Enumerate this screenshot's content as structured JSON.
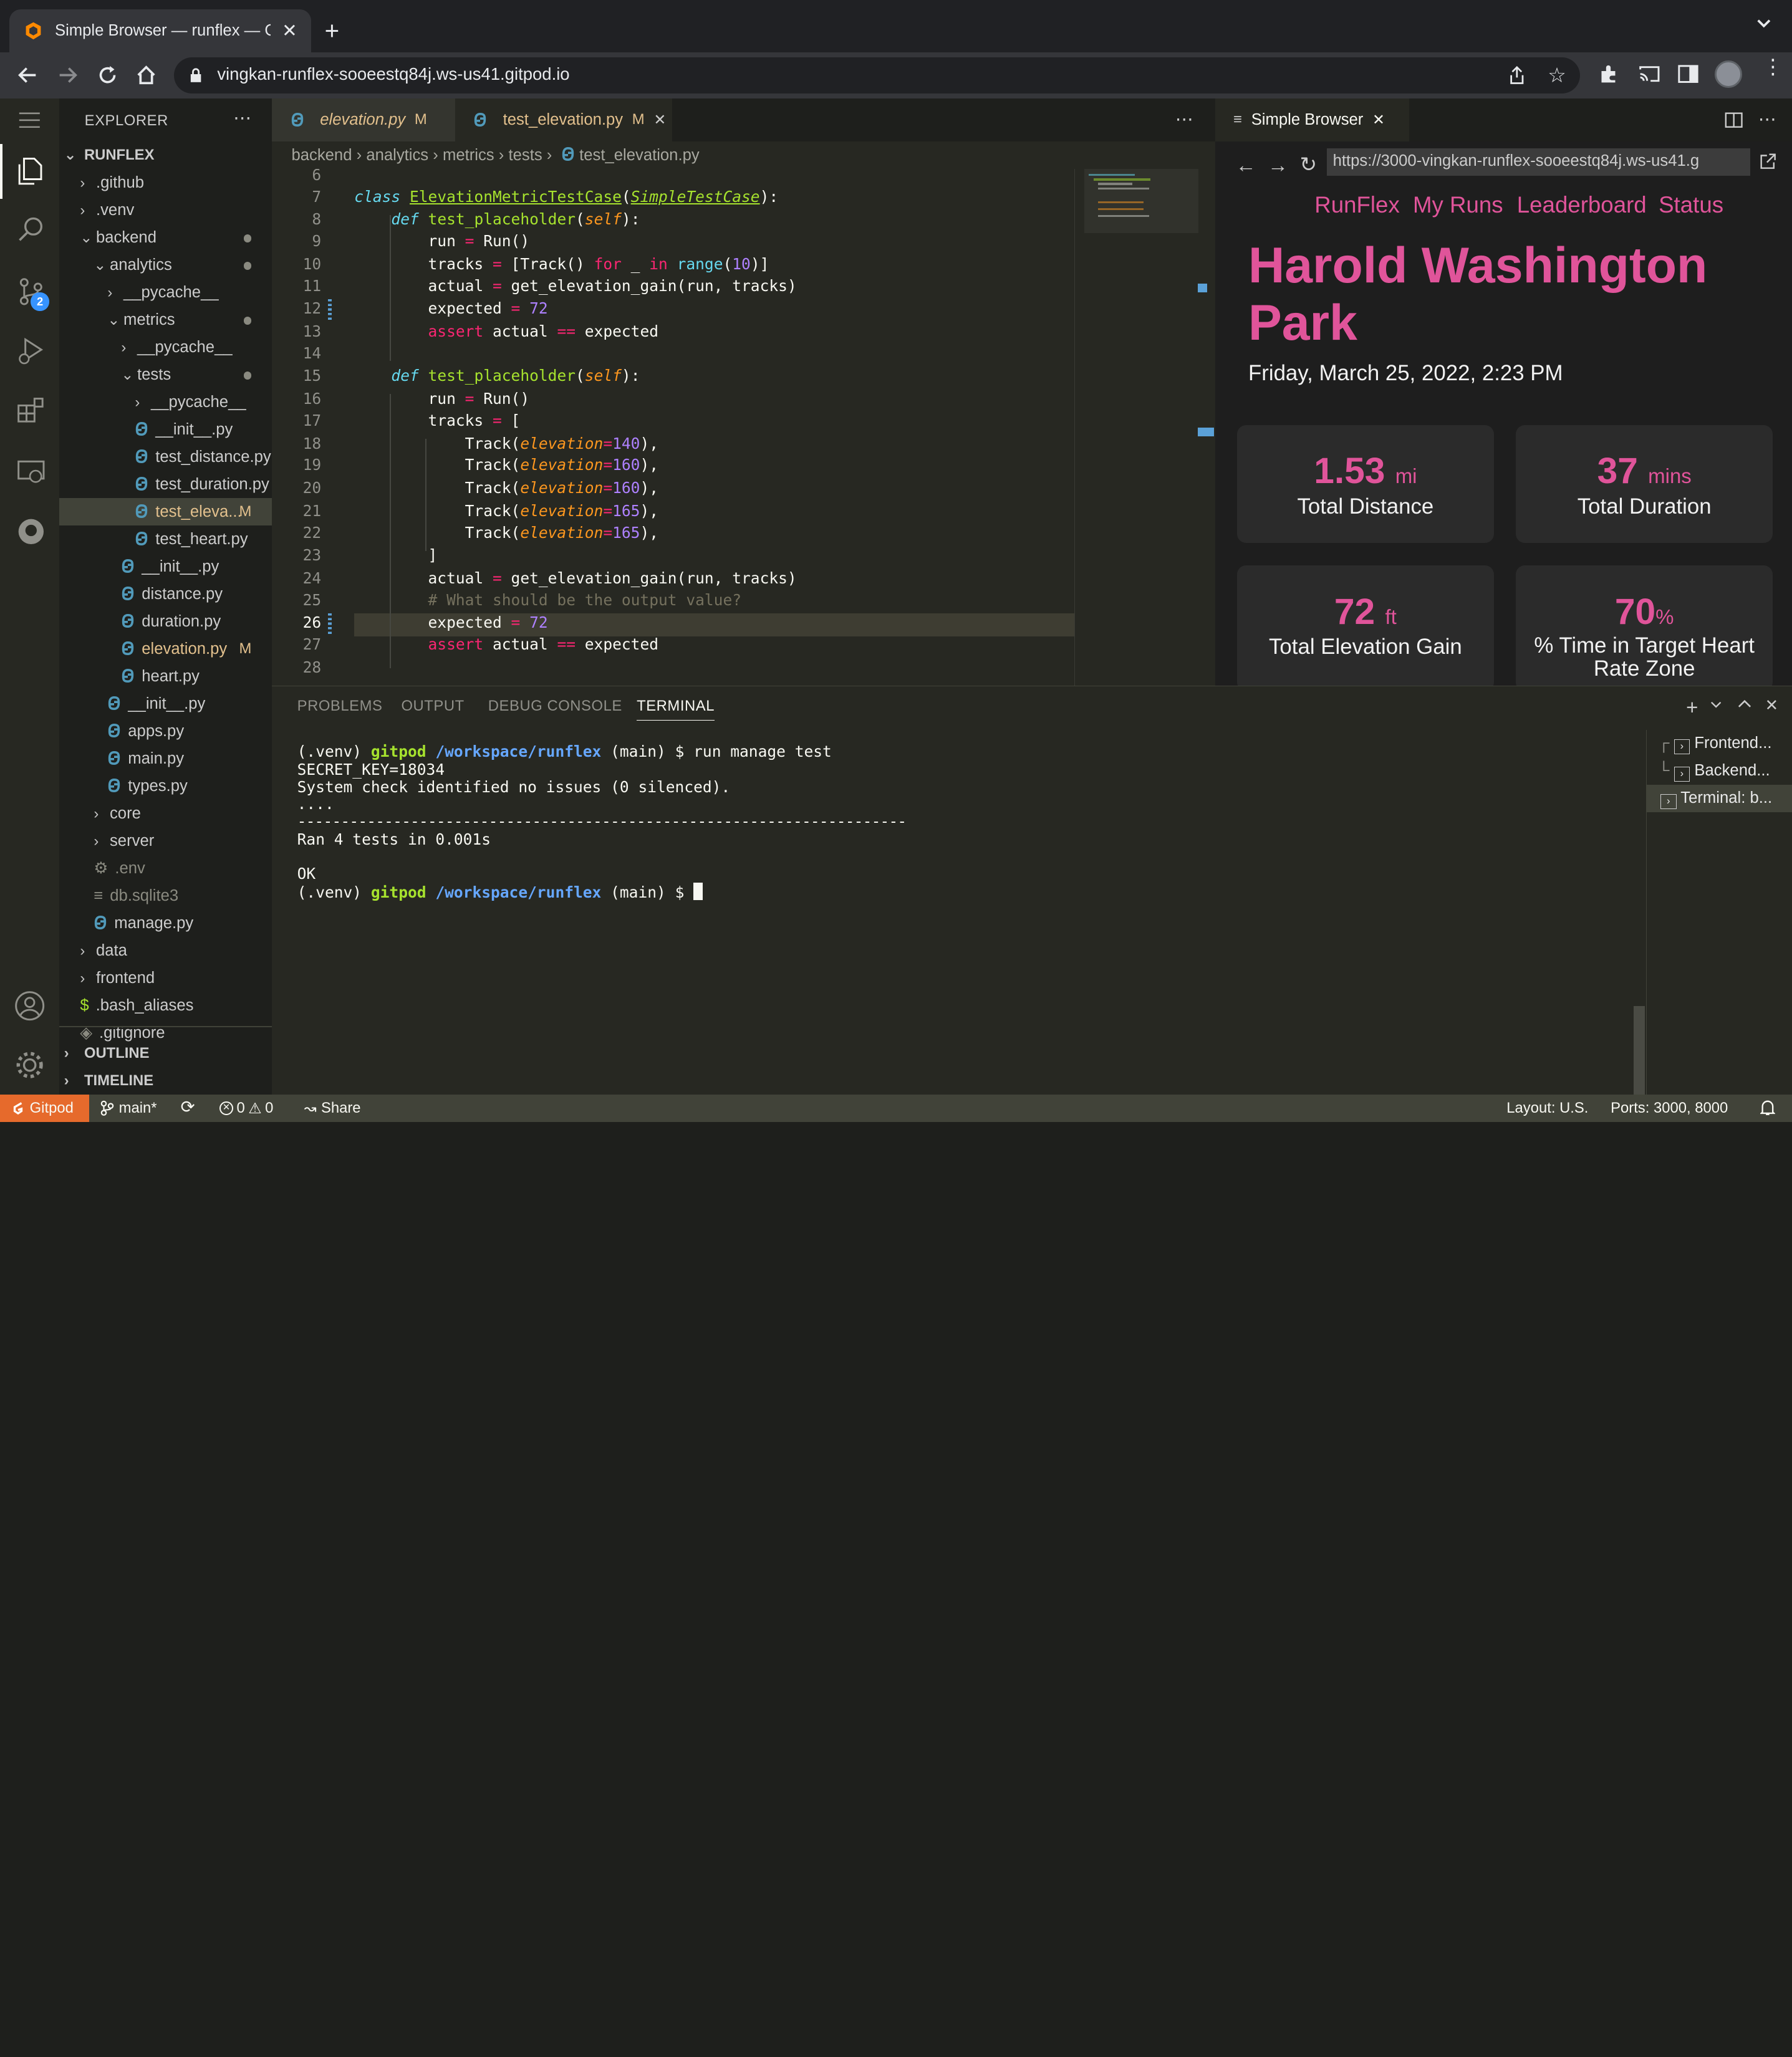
{
  "chrome": {
    "tab_title": "Simple Browser — runflex — G",
    "address": "vingkan-runflex-sooeestq84j.ws-us41.gitpod.io"
  },
  "explorer": {
    "title": "EXPLORER",
    "root": "RUNFLEX",
    "items": [
      {
        "label": ".github"
      },
      {
        "label": ".venv"
      },
      {
        "label": "backend"
      },
      {
        "label": "analytics"
      },
      {
        "label": "__pycache__"
      },
      {
        "label": "metrics"
      },
      {
        "label": "__pycache__"
      },
      {
        "label": "tests"
      },
      {
        "label": "__pycache__"
      },
      {
        "label": "__init__.py"
      },
      {
        "label": "test_distance.py"
      },
      {
        "label": "test_duration.py"
      },
      {
        "label": "test_eleva...",
        "badge": "M"
      },
      {
        "label": "test_heart.py"
      },
      {
        "label": "__init__.py"
      },
      {
        "label": "distance.py"
      },
      {
        "label": "duration.py"
      },
      {
        "label": "elevation.py",
        "badge": "M"
      },
      {
        "label": "heart.py"
      },
      {
        "label": "__init__.py"
      },
      {
        "label": "apps.py"
      },
      {
        "label": "main.py"
      },
      {
        "label": "types.py"
      },
      {
        "label": "core"
      },
      {
        "label": "server"
      },
      {
        "label": ".env"
      },
      {
        "label": "db.sqlite3"
      },
      {
        "label": "manage.py"
      },
      {
        "label": "data"
      },
      {
        "label": "frontend"
      },
      {
        "label": ".bash_aliases"
      },
      {
        "label": ".gitignore"
      }
    ],
    "outline": "OUTLINE",
    "timeline": "TIMELINE",
    "scm_badge": "2"
  },
  "editor": {
    "tabs": [
      {
        "label": "elevation.py",
        "badge": "M"
      },
      {
        "label": "test_elevation.py",
        "badge": "M"
      }
    ],
    "breadcrumb": [
      "backend",
      "analytics",
      "metrics",
      "tests",
      "test_elevation.py"
    ],
    "line_numbers": [
      "6",
      "7",
      "8",
      "9",
      "10",
      "11",
      "12",
      "13",
      "14",
      "15",
      "16",
      "17",
      "18",
      "19",
      "20",
      "21",
      "22",
      "23",
      "24",
      "25",
      "26",
      "27",
      "28"
    ]
  },
  "simple_browser": {
    "tab_label": "Simple Browser",
    "url": "https://3000-vingkan-runflex-sooeestq84j.ws-us41.g",
    "nav": [
      "RunFlex",
      "My Runs",
      "Leaderboard",
      "Status"
    ],
    "title": "Harold Washington Park",
    "date": "Friday, March 25, 2022, 2:23 PM",
    "stats": [
      {
        "value": "1.53",
        "unit": "mi",
        "label": "Total Distance"
      },
      {
        "value": "37",
        "unit": "mins",
        "label": "Total Duration"
      },
      {
        "value": "72",
        "unit": "ft",
        "label": "Total Elevation Gain"
      },
      {
        "value": "70",
        "unit": "%",
        "label": "% Time in Target Heart Rate Zone"
      }
    ]
  },
  "panel": {
    "tabs": [
      "PROBLEMS",
      "OUTPUT",
      "DEBUG CONSOLE",
      "TERMINAL"
    ],
    "active_tab": "TERMINAL",
    "terminals": [
      "Frontend...",
      "Backend...",
      "Terminal: b..."
    ],
    "lines": {
      "prompt_env": "(.venv)",
      "prompt_user": "gitpod",
      "prompt_path": "/workspace/runflex",
      "prompt_branch": "(main) $",
      "command": "run manage test",
      "l2": "SECRET_KEY=18034",
      "l3": "System check identified no issues (0 silenced).",
      "l4": "....",
      "l5": "----------------------------------------------------------------------",
      "l6": "Ran 4 tests in 0.001s",
      "l7": "OK"
    }
  },
  "statusbar": {
    "gitpod": "Gitpod",
    "branch": "main*",
    "errors": "0",
    "warnings": "0",
    "share": "Share",
    "layout": "Layout: U.S.",
    "ports": "Ports: 3000, 8000"
  },
  "colors": {
    "accent_pink": "#e0549a",
    "gitpod_orange": "#e66a2c",
    "editor_bg": "#272822"
  }
}
